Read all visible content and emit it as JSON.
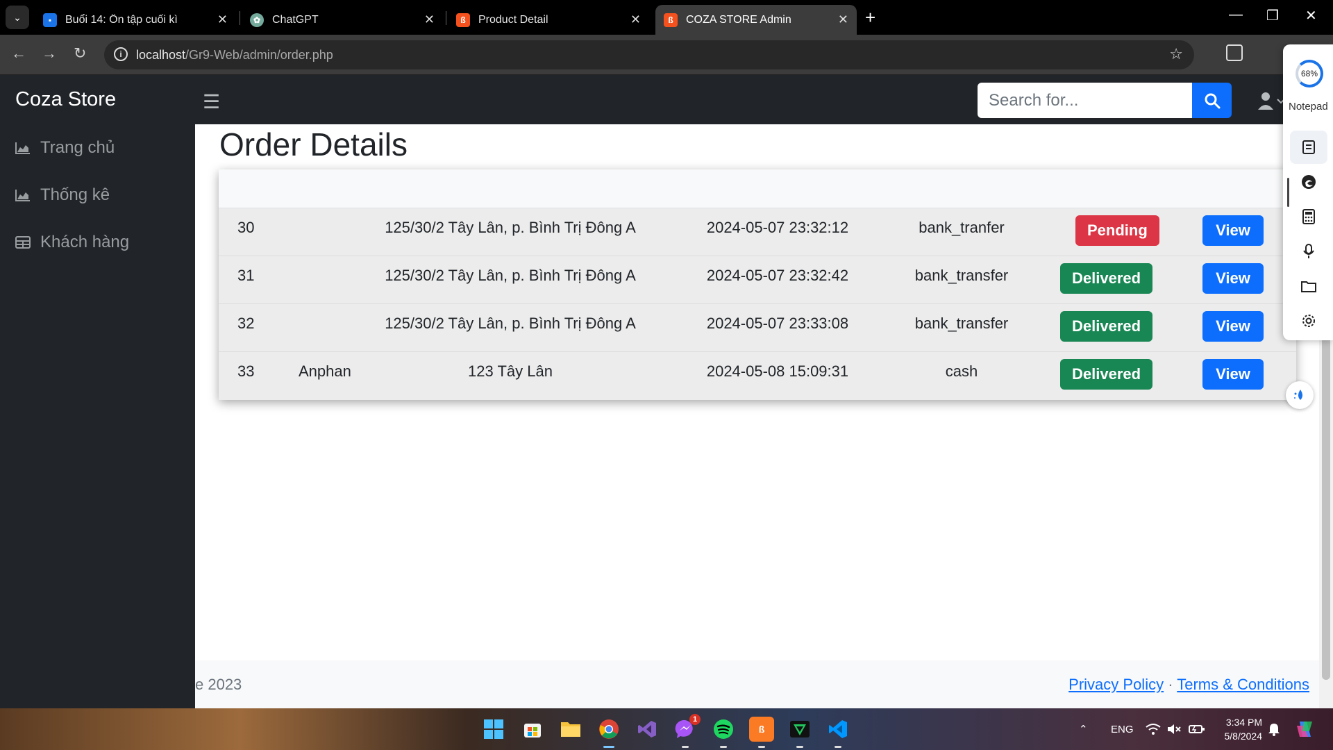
{
  "browser": {
    "tabs": [
      {
        "title": "Buổi 14: Ôn tập cuối kì",
        "icon": "classroom-icon",
        "color": "#1a73e8"
      },
      {
        "title": "ChatGPT",
        "icon": "chatgpt-icon",
        "color": "#74aa9c"
      },
      {
        "title": "Product Detail",
        "icon": "coza-icon",
        "color": "#f4511e"
      },
      {
        "title": "COZA STORE Admin",
        "icon": "coza-icon",
        "color": "#f4511e"
      }
    ],
    "url_host": "localhost",
    "url_path": "/Gr9-Web/admin/order.php"
  },
  "app": {
    "brand": "Coza Store",
    "search_placeholder": "Search for...",
    "sidebar": [
      {
        "label": "Trang chủ",
        "icon": "chart-area-icon"
      },
      {
        "label": "Thống kê",
        "icon": "chart-area-icon"
      },
      {
        "label": "Khách hàng",
        "icon": "table-icon"
      }
    ],
    "page_title": "Order Details",
    "orders": [
      {
        "id": "30",
        "name": "",
        "address": "125/30/2 Tây Lân, p. Bình Trị Đông A",
        "date": "2024-05-07 23:32:12",
        "payment": "bank_tranfer",
        "status": "Pending",
        "action": "View"
      },
      {
        "id": "31",
        "name": "",
        "address": "125/30/2 Tây Lân, p. Bình Trị Đông A",
        "date": "2024-05-07 23:32:42",
        "payment": "bank_transfer",
        "status": "Delivered",
        "action": "View"
      },
      {
        "id": "32",
        "name": "",
        "address": "125/30/2 Tây Lân, p. Bình Trị Đông A",
        "date": "2024-05-07 23:33:08",
        "payment": "bank_transfer",
        "status": "Delivered",
        "action": "View"
      },
      {
        "id": "33",
        "name": "Anphan",
        "address": "123 Tây Lân",
        "date": "2024-05-08 15:09:31",
        "payment": "cash",
        "status": "Delivered",
        "action": "View"
      }
    ],
    "footer": {
      "copyright": "e 2023",
      "privacy": "Privacy Policy",
      "separator": "·",
      "terms": "Terms & Conditions"
    },
    "colors": {
      "danger": "#dc3545",
      "success": "#198754",
      "primary": "#0d6efd",
      "dark": "#212529"
    }
  },
  "side_panel": {
    "gauge": "68%",
    "label": "Notepad"
  },
  "taskbar": {
    "apps": [
      "windows-start-icon",
      "microsoft-store-icon",
      "file-explorer-icon",
      "chrome-icon",
      "visual-studio-icon",
      "messenger-icon",
      "spotify-icon",
      "xampp-icon",
      "terminal-icon",
      "vscode-icon"
    ],
    "messenger_badge": "1",
    "language": "ENG",
    "time": "3:34 PM",
    "date": "5/8/2024"
  }
}
